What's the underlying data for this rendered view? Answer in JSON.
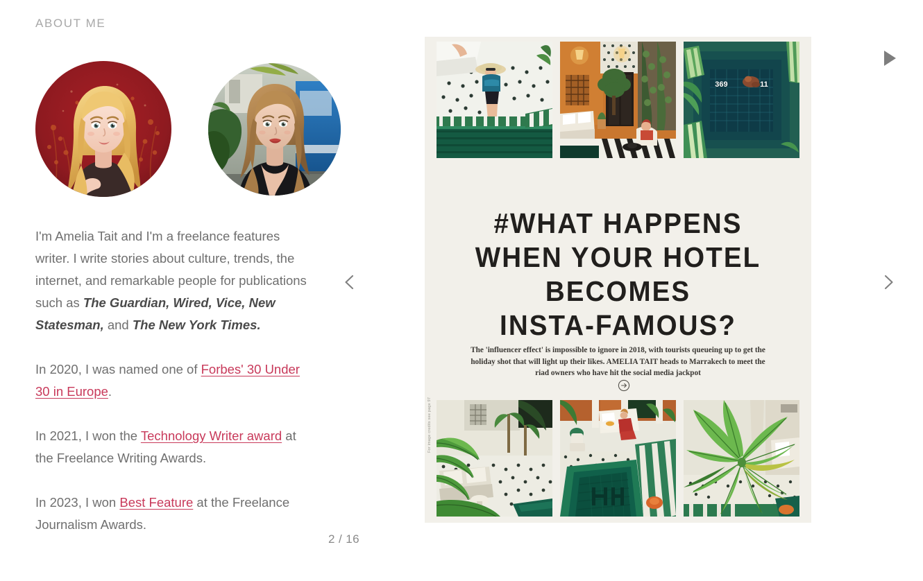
{
  "section": {
    "heading": "ABOUT ME"
  },
  "avatars": [
    {
      "name": "illustrated-portrait",
      "alt": "Illustrated portrait of a blonde woman on a deep red floral background"
    },
    {
      "name": "photo-portrait",
      "alt": "Photograph of a blonde woman in a black top outdoors with greenery and a blue vehicle behind"
    }
  ],
  "bio": {
    "paragraph_1": {
      "part_1": "I'm Amelia Tait and I'm a freelance features writer. I write stories about culture, trends, the internet, and remarkable people for publications such as ",
      "emphasis_1": "The Guardian, Wired, Vice, New Statesman,",
      "part_2": " and ",
      "emphasis_2": "The New York Times."
    },
    "paragraph_2": {
      "part_1": "In 2020, I was named one of ",
      "link": "Forbes' 30 Under 30 in Europe",
      "part_2": "."
    },
    "paragraph_3": {
      "part_1": "In 2021, I won the ",
      "link": "Technology Writer award",
      "part_2": " at the Freelance Writing Awards."
    },
    "paragraph_4": {
      "part_1": "In 2023, I won ",
      "link": "Best Feature",
      "part_2": " at the Freelance Journalism Awards."
    }
  },
  "carousel": {
    "counter": "2 / 16",
    "prev_label": "previous-slide",
    "next_label": "next-slide",
    "play_label": "play-slideshow"
  },
  "spread": {
    "headline_lines": [
      "#WHAT HAPPENS",
      "WHEN YOUR HOTEL",
      "BECOMES",
      "INSTA-FAMOUS?"
    ],
    "standfirst": "The 'influencer effect' is impossible to ignore in 2018, with tourists queueing up to get the holiday shot that will light up their likes. AMELIA TAIT heads to Marrakech to meet the riad owners who have hit the social media jackpot",
    "credit": "For image credits see page 97",
    "top_photos": [
      {
        "name": "poolside-sunhat-photo",
        "likes": "",
        "comments": ""
      },
      {
        "name": "riad-courtyard-photo",
        "likes": "",
        "comments": ""
      },
      {
        "name": "aerial-pool-photo",
        "likes": "369",
        "comments": "11"
      }
    ],
    "bottom_photos": [
      {
        "name": "courtyard-banana-palms-photo"
      },
      {
        "name": "green-pool-overhead-photo"
      },
      {
        "name": "banana-plant-photo"
      }
    ],
    "background_color": "#f2f0ea"
  },
  "colors": {
    "link": "#c8395a",
    "body_text": "#6f6f6f",
    "heading_text": "#a8a8a8",
    "headline_text": "#211f1d"
  }
}
